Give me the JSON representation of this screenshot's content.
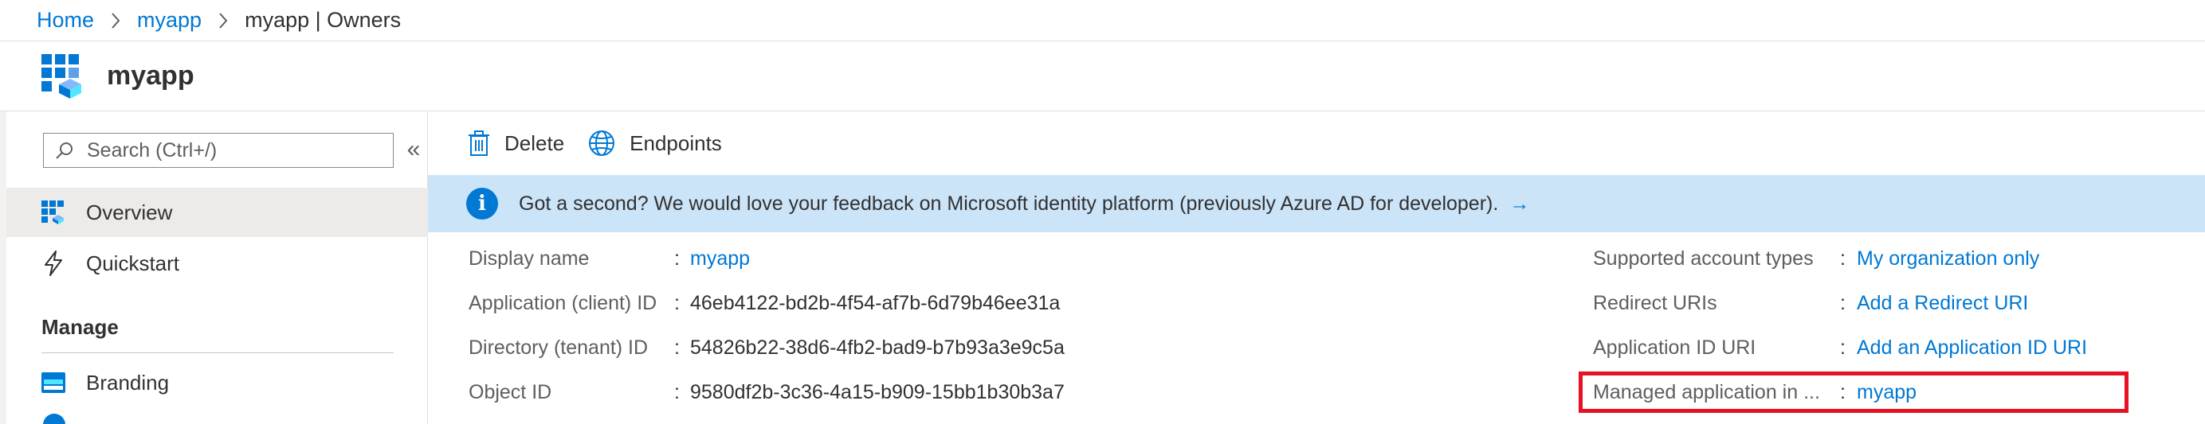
{
  "breadcrumb": {
    "items": [
      "Home",
      "myapp",
      "myapp | Owners"
    ]
  },
  "header": {
    "title": "myapp"
  },
  "sidebar": {
    "search_placeholder": "Search (Ctrl+/)",
    "collapse_glyph": "«",
    "items": [
      {
        "label": "Overview",
        "icon": "app-grid-icon",
        "active": true
      },
      {
        "label": "Quickstart",
        "icon": "lightning-icon",
        "active": false
      }
    ],
    "section_manage": "Manage",
    "manage_items": [
      {
        "label": "Branding",
        "icon": "branding-icon"
      }
    ]
  },
  "toolbar": {
    "delete_label": "Delete",
    "endpoints_label": "Endpoints"
  },
  "banner": {
    "text": "Got a second? We would love your feedback on Microsoft identity platform (previously Azure AD for developer).",
    "arrow": "→"
  },
  "essentials": {
    "left": [
      {
        "label": "Display name",
        "value": "myapp",
        "link": true
      },
      {
        "label": "Application (client) ID",
        "value": "46eb4122-bd2b-4f54-af7b-6d79b46ee31a",
        "link": false
      },
      {
        "label": "Directory (tenant) ID",
        "value": "54826b22-38d6-4fb2-bad9-b7b93a3e9c5a",
        "link": false
      },
      {
        "label": "Object ID",
        "value": "9580df2b-3c36-4a15-b909-15bb1b30b3a7",
        "link": false
      }
    ],
    "right": [
      {
        "label": "Supported account types",
        "value": "My organization only",
        "link": true
      },
      {
        "label": "Redirect URIs",
        "value": "Add a Redirect URI",
        "link": true
      },
      {
        "label": "Application ID URI",
        "value": "Add an Application ID URI",
        "link": true
      },
      {
        "label": "Managed application in ...",
        "value": "myapp",
        "link": true
      }
    ],
    "colon": ":"
  },
  "colors": {
    "accent": "#0078d4",
    "banner_bg": "#cce4f8",
    "highlight": "#e81123"
  }
}
